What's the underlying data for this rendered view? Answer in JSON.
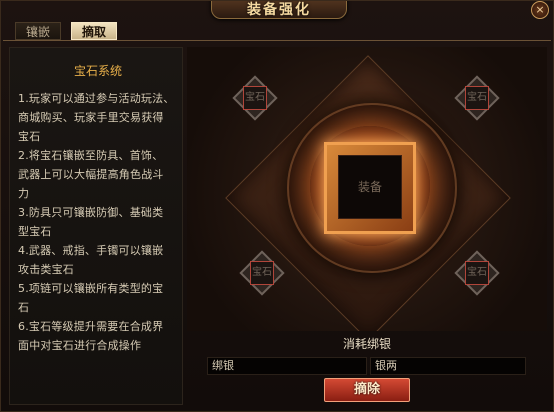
{
  "window": {
    "title": "装备强化",
    "close_glyph": "×"
  },
  "tabs": [
    {
      "label": "镶嵌",
      "active": false
    },
    {
      "label": "摘取",
      "active": true
    }
  ],
  "info": {
    "title": "宝石系统",
    "lines": [
      "1.玩家可以通过参与活动玩法、",
      "商城购买、玩家手里交易获得",
      "宝石",
      "2.将宝石镶嵌至防具、首饰、",
      "武器上可以大幅提高角色战斗",
      "力",
      "3.防具只可镶嵌防御、基础类",
      "型宝石",
      "4.武器、戒指、手镯可以镶嵌",
      "攻击类宝石",
      "5.项链可以镶嵌所有类型的宝",
      "石",
      "6.宝石等级提升需要在合成界",
      "面中对宝石进行合成操作"
    ]
  },
  "stage": {
    "equip_slot_label": "装备",
    "gem_slots": [
      {
        "label": "宝石",
        "position": "top-left"
      },
      {
        "label": "宝石",
        "position": "top-right"
      },
      {
        "label": "宝石",
        "position": "bottom-left"
      },
      {
        "label": "宝石",
        "position": "bottom-right"
      }
    ]
  },
  "cost": {
    "label": "消耗绑银",
    "left_field": "绑银",
    "right_field": "银两"
  },
  "buttons": {
    "remove_label": "摘除"
  },
  "colors": {
    "accent_gold": "#e8b04a",
    "button_red": "#d44a34",
    "equip_glow": "#ff9a40"
  },
  "icons": {
    "close": "close-icon"
  }
}
